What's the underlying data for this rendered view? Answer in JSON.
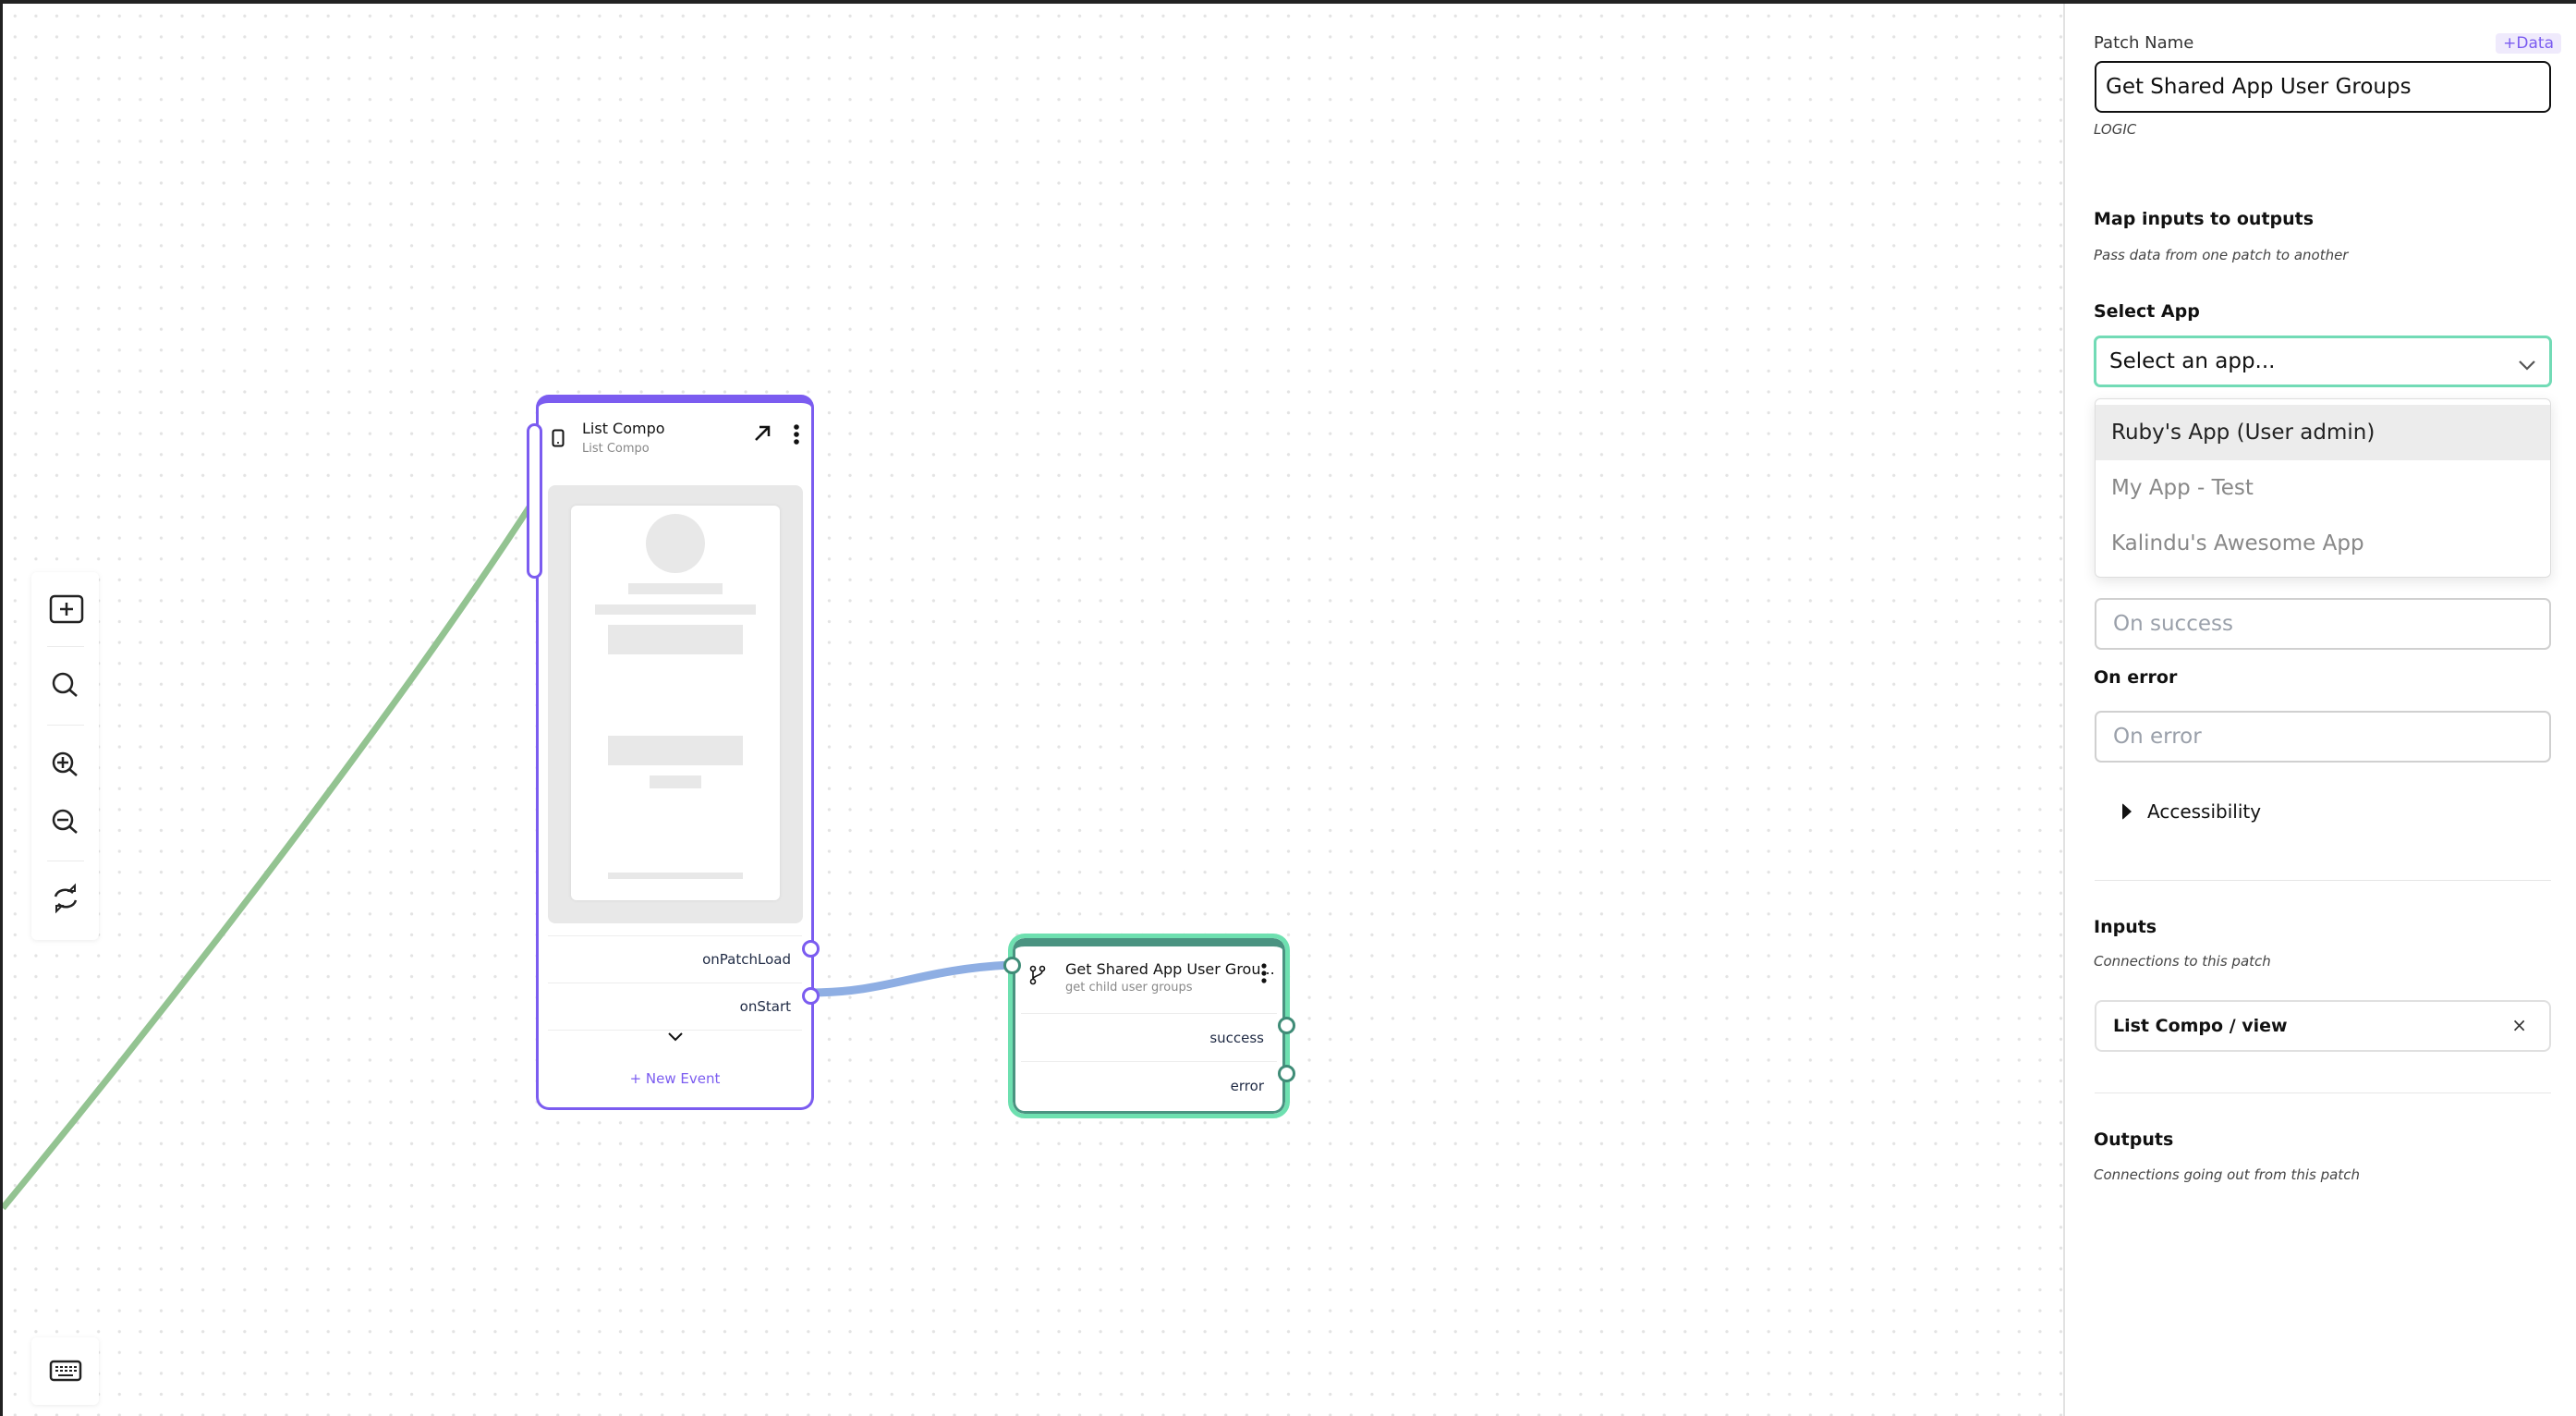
{
  "canvas": {
    "toolbar": {
      "items": [
        {
          "icon": "add-node-icon"
        },
        {
          "icon": "search-icon"
        },
        {
          "icon": "zoom-in-icon"
        },
        {
          "icon": "zoom-out-icon"
        },
        {
          "icon": "refresh-icon"
        }
      ]
    },
    "keyboard_icon": "keyboard-icon",
    "nodes": {
      "list_compo": {
        "title": "List Compo",
        "subtitle": "List Compo",
        "accent": "#7b5cf0",
        "events": [
          "onPatchLoad",
          "onStart"
        ],
        "new_event_label": "+ New Event"
      },
      "get_shared": {
        "title": "Get Shared App User Grou...",
        "subtitle": "get child user groups",
        "accent": "#6ee0b0",
        "outputs": [
          "success",
          "error"
        ]
      }
    },
    "wire_colors": {
      "incoming": "#93c391",
      "onStart_to_get_shared": "#8eaee3"
    }
  },
  "panel": {
    "patch_name_label": "Patch Name",
    "data_button": "+Data",
    "patch_name_value": "Get Shared App User Groups",
    "patch_type": "LOGIC",
    "map_title": "Map inputs to outputs",
    "map_subtitle": "Pass data from one patch to another",
    "select_app_label": "Select App",
    "select_app_value": "Select an app...",
    "app_options": [
      {
        "label": "Ruby's App (User admin)",
        "highlighted": true
      },
      {
        "label": "My App - Test",
        "highlighted": false
      },
      {
        "label": "Kalindu's Awesome App",
        "highlighted": false
      }
    ],
    "on_success_placeholder": "On success",
    "on_error_label": "On error",
    "on_error_placeholder": "On error",
    "accessibility_label": "Accessibility",
    "inputs_title": "Inputs",
    "inputs_subtitle": "Connections to this patch",
    "input_connections": [
      {
        "label": "List Compo / view",
        "remove_icon": "×"
      }
    ],
    "outputs_title": "Outputs",
    "outputs_subtitle": "Connections going out from this patch"
  }
}
